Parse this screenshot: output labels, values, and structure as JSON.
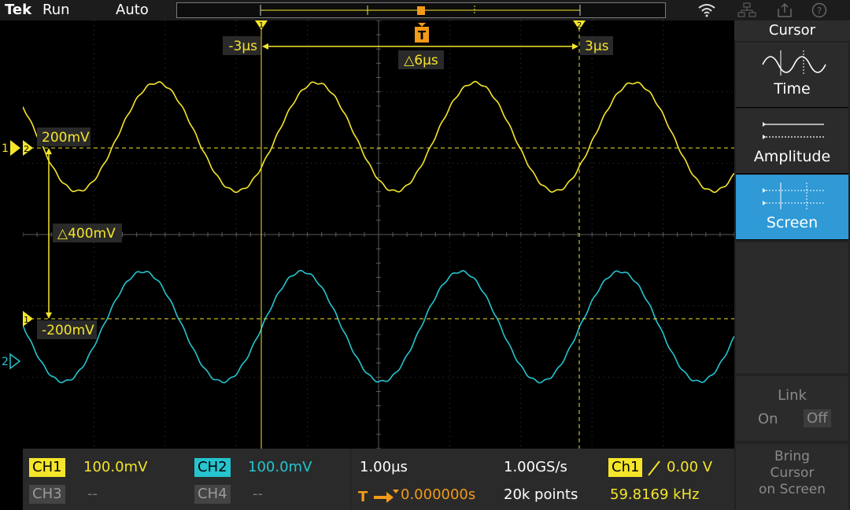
{
  "topbar": {
    "brand": "Tek",
    "run_state": "Run",
    "trigger_mode": "Auto"
  },
  "colors": {
    "ch1": "#f4e52a",
    "ch2": "#25c4cf",
    "trigger": "#f29a1a",
    "accent": "#2f9ad6"
  },
  "sidebar": {
    "title": "Cursor",
    "buttons": [
      {
        "label": "Time",
        "icon": "sine-time-cursor-icon"
      },
      {
        "label": "Amplitude",
        "icon": "amplitude-cursor-icon"
      },
      {
        "label": "Screen",
        "icon": "screen-cursor-icon",
        "active": true
      }
    ],
    "link": {
      "label": "Link",
      "on": "On",
      "off": "Off"
    },
    "bring": {
      "line1": "Bring",
      "line2": "Cursor",
      "line3": "on Screen"
    }
  },
  "readouts": {
    "time_cursor1": "-3µs",
    "time_cursor2": "3µs",
    "delta_time": "△6µs",
    "amp_cursor2": "200mV",
    "amp_cursor1": "-200mV",
    "delta_amp": "△400mV",
    "cursor1_marker": "1",
    "cursor2_marker": "2",
    "trigger_marker": "T",
    "ch1_marker": "1",
    "ch2_marker": "2"
  },
  "channels": {
    "ch1": {
      "label": "CH1",
      "scale": "100.0mV"
    },
    "ch2": {
      "label": "CH2",
      "scale": "100.0mV"
    },
    "ch3": {
      "label": "CH3",
      "scale": "--"
    },
    "ch4": {
      "label": "CH4",
      "scale": "--"
    }
  },
  "horizontal": {
    "scale": "1.00µs",
    "sample_rate": "1.00GS/s",
    "delay": "0.000000s",
    "record_length": "20k points",
    "trigger_source": "Ch1",
    "trigger_level": "0.00 V",
    "frequency": "59.8169 kHz"
  }
}
